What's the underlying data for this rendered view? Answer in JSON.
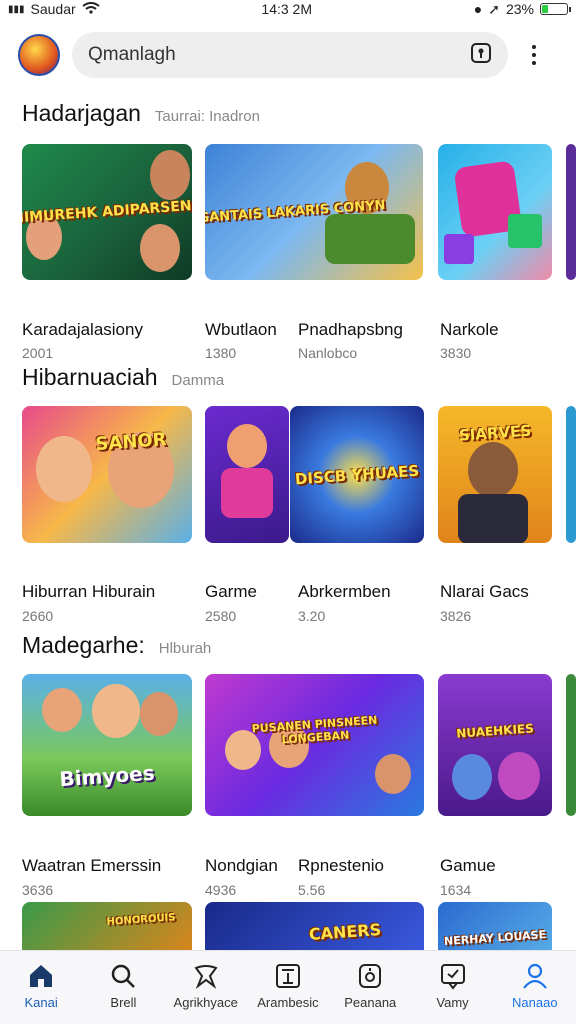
{
  "status_bar": {
    "carrier": "Saudar",
    "time": "14:3 2M",
    "battery": "23%"
  },
  "search": {
    "placeholder": "Qmanlagh"
  },
  "sections": [
    {
      "title": "Hadarjagan",
      "subtitle": "Taurrai:  Inadron",
      "tiles": [
        {
          "title": "Karadajalasiony",
          "number": "2001",
          "badge": "HIMUREHK ADIPARSENS"
        },
        {
          "title": "Wbutlaon",
          "number": "1380",
          "badge": "GANTAIS LAKARIS CONYN"
        },
        {
          "title": "Pnadhapsbng",
          "number": "Nanlobco",
          "badge": ""
        },
        {
          "title": "Narkole",
          "number": "3830",
          "badge": ""
        }
      ]
    },
    {
      "title": "Hibarnuaciah",
      "subtitle": "Damma",
      "tiles": [
        {
          "title": "Hiburran Hiburain",
          "number": "2660",
          "badge": "SANOR"
        },
        {
          "title": "Garme",
          "number": "2580",
          "badge": ""
        },
        {
          "title": "Abrkermben",
          "number": "3.20",
          "badge": "DISCB YHUAES"
        },
        {
          "title": "Nlarai Gacs",
          "number": "3826",
          "badge": "SIARVES"
        }
      ]
    },
    {
      "title": "Madegarhe:",
      "subtitle": "Hlburah",
      "tiles": [
        {
          "title": "Waatran Emerssin",
          "number": "3636",
          "badge": "Bimyoes"
        },
        {
          "title": "Nondgian",
          "number": "4936",
          "badge": "PUSANEN PINSNEEN LONGEBAN"
        },
        {
          "title": "Rpnestenio",
          "number": "5.56",
          "badge": ""
        },
        {
          "title": "Gamue",
          "number": "1634",
          "badge": "NUAEHKIES"
        }
      ]
    },
    {
      "title": "",
      "subtitle": "",
      "tiles": [
        {
          "title": "",
          "number": "",
          "badge": "HONOROUIS"
        },
        {
          "title": "",
          "number": "",
          "badge": "CANERS"
        },
        {
          "title": "",
          "number": "",
          "badge": "NERHAY LOUASE"
        }
      ]
    }
  ],
  "bottom_nav": [
    {
      "label": "Kanai",
      "icon": "home-icon"
    },
    {
      "label": "Brell",
      "icon": "search-icon"
    },
    {
      "label": "Agrikhyace",
      "icon": "tag-icon"
    },
    {
      "label": "Arambesic",
      "icon": "add-box-icon"
    },
    {
      "label": "Peanana",
      "icon": "game-icon"
    },
    {
      "label": "Vamy",
      "icon": "chat-icon"
    },
    {
      "label": "Nanaao",
      "icon": "person-icon"
    }
  ],
  "colors": {
    "accent": "#1a73e8",
    "nav_bg": "#f7f7f9",
    "search_bg": "#eeeeef"
  }
}
